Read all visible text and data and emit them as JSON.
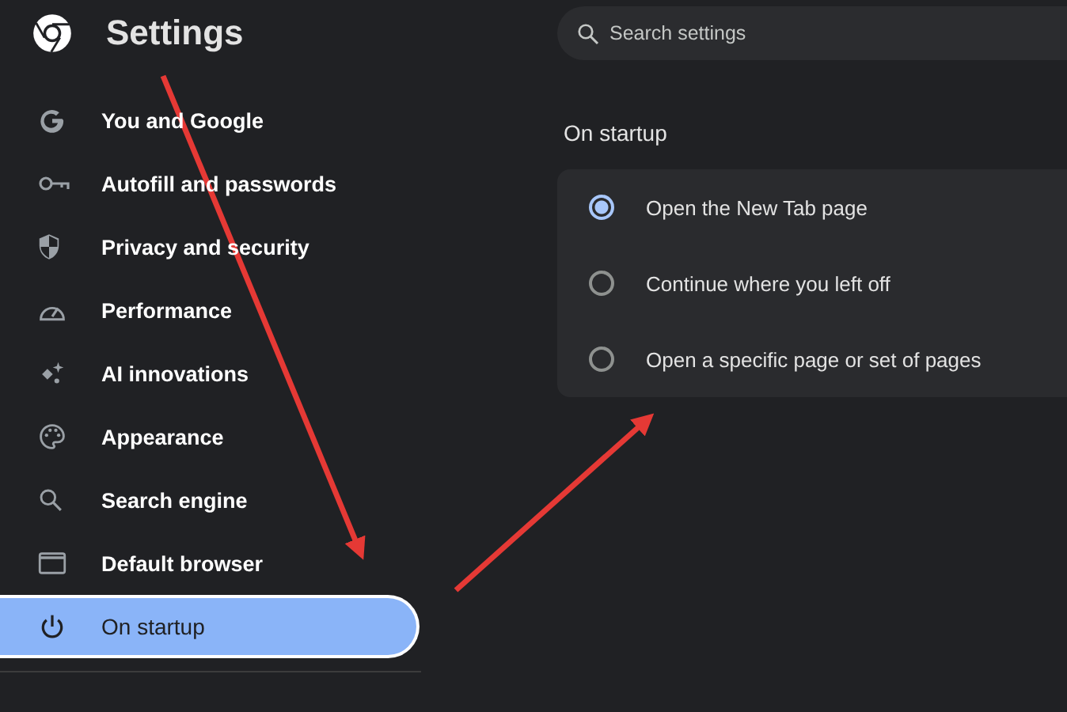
{
  "header": {
    "title": "Settings"
  },
  "search": {
    "placeholder": "Search settings"
  },
  "sidebar": {
    "items": [
      {
        "label": "You and Google",
        "selected": false
      },
      {
        "label": "Autofill and passwords",
        "selected": false
      },
      {
        "label": "Privacy and security",
        "selected": false
      },
      {
        "label": "Performance",
        "selected": false
      },
      {
        "label": "AI innovations",
        "selected": false
      },
      {
        "label": "Appearance",
        "selected": false
      },
      {
        "label": "Search engine",
        "selected": false
      },
      {
        "label": "Default browser",
        "selected": false
      },
      {
        "label": "On startup",
        "selected": true
      }
    ]
  },
  "section": {
    "title": "On startup",
    "options": [
      {
        "label": "Open the New Tab page",
        "selected": true
      },
      {
        "label": "Continue where you left off",
        "selected": false
      },
      {
        "label": "Open a specific page or set of pages",
        "selected": false
      }
    ]
  }
}
